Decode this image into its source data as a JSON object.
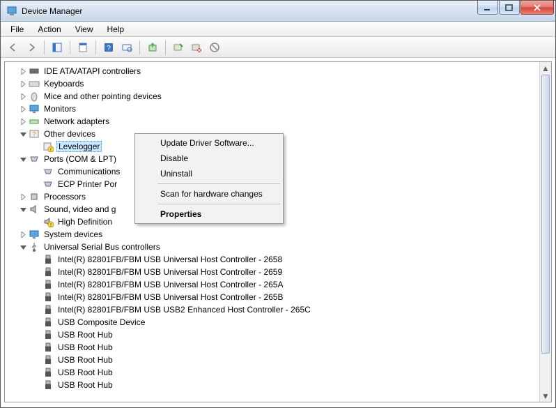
{
  "window": {
    "title": "Device Manager"
  },
  "menu": {
    "items": [
      "File",
      "Action",
      "View",
      "Help"
    ]
  },
  "tree": {
    "ide": "IDE ATA/ATAPI controllers",
    "keyboards": "Keyboards",
    "mice": "Mice and other pointing devices",
    "monitors": "Monitors",
    "network": "Network adapters",
    "other": "Other devices",
    "levelogger": "Levelogger",
    "ports": "Ports (COM & LPT)",
    "commport": "Communications",
    "ecpport": "ECP Printer Por",
    "processors": "Processors",
    "sound": "Sound, video and g",
    "hdaudio": "High Definition",
    "system": "System devices",
    "usb": "Universal Serial Bus controllers",
    "usb_items": [
      "Intel(R) 82801FB/FBM USB Universal Host Controller - 2658",
      "Intel(R) 82801FB/FBM USB Universal Host Controller - 2659",
      "Intel(R) 82801FB/FBM USB Universal Host Controller - 265A",
      "Intel(R) 82801FB/FBM USB Universal Host Controller - 265B",
      "Intel(R) 82801FB/FBM USB USB2 Enhanced Host Controller - 265C",
      "USB Composite Device",
      "USB Root Hub",
      "USB Root Hub",
      "USB Root Hub",
      "USB Root Hub",
      "USB Root Hub"
    ]
  },
  "context_menu": {
    "update": "Update Driver Software...",
    "disable": "Disable",
    "uninstall": "Uninstall",
    "scan": "Scan for hardware changes",
    "properties": "Properties"
  }
}
